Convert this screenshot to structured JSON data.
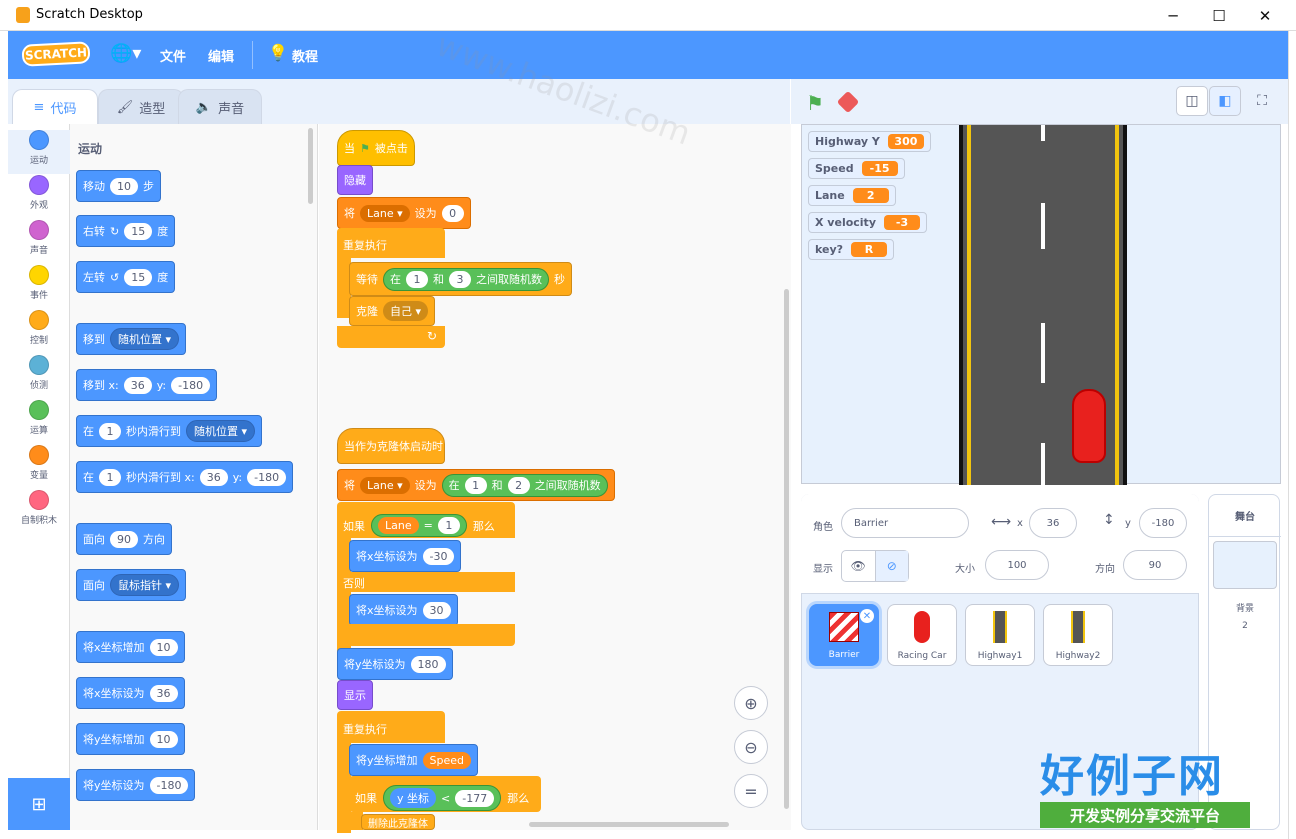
{
  "window": {
    "title": "Scratch Desktop",
    "controls": [
      "─",
      "☐",
      "✕"
    ]
  },
  "menu": {
    "logo": "SCRATCH",
    "globe_icon": "globe-icon",
    "file": "文件",
    "edit": "编辑",
    "tutorials": "教程"
  },
  "tabs": {
    "code": "代码",
    "costumes": "造型",
    "sounds": "声音"
  },
  "categories": [
    {
      "label": "运动",
      "color": "#4c97ff"
    },
    {
      "label": "外观",
      "color": "#9966ff"
    },
    {
      "label": "声音",
      "color": "#cf63cf"
    },
    {
      "label": "事件",
      "color": "#ffd500"
    },
    {
      "label": "控制",
      "color": "#ffab19"
    },
    {
      "label": "侦测",
      "color": "#5cb1d6"
    },
    {
      "label": "运算",
      "color": "#59c059"
    },
    {
      "label": "变量",
      "color": "#ff8c1a"
    },
    {
      "label": "自制积木",
      "color": "#ff6680"
    }
  ],
  "palette": {
    "heading": "运动",
    "b1": {
      "t1": "移动",
      "v1": "10",
      "t2": "步"
    },
    "b2": {
      "t1": "右转",
      "v1": "15",
      "t2": "度"
    },
    "b3": {
      "t1": "左转",
      "v1": "15",
      "t2": "度"
    },
    "b4": {
      "t1": "移到",
      "v1": "随机位置"
    },
    "b5": {
      "t1": "移到 x:",
      "v1": "36",
      "t2": "y:",
      "v2": "-180"
    },
    "b6": {
      "t1": "在",
      "v1": "1",
      "t2": "秒内滑行到",
      "v2": "随机位置"
    },
    "b7": {
      "t1": "在",
      "v1": "1",
      "t2": "秒内滑行到 x:",
      "v2": "36",
      "t3": "y:",
      "v3": "-180"
    },
    "b8": {
      "t1": "面向",
      "v1": "90",
      "t2": "方向"
    },
    "b9": {
      "t1": "面向",
      "v1": "鼠标指针"
    },
    "b10": {
      "t1": "将x坐标增加",
      "v1": "10"
    },
    "b11": {
      "t1": "将x坐标设为",
      "v1": "36"
    },
    "b12": {
      "t1": "将y坐标增加",
      "v1": "10"
    },
    "b13": {
      "t1": "将y坐标设为",
      "v1": "-180"
    }
  },
  "script1": {
    "hat_when": "当",
    "hat_clicked": "被点击",
    "hide": "隐藏",
    "set": "将",
    "set_var": "Lane",
    "set_to": "设为",
    "set_val": "0",
    "forever": "重复执行",
    "wait": "等待",
    "wait_in": "在",
    "wait_a": "1",
    "wait_and": "和",
    "wait_b": "3",
    "wait_rand": "之间取随机数",
    "wait_sec": "秒",
    "clone": "克隆",
    "clone_target": "自己"
  },
  "script2": {
    "hat": "当作为克隆体启动时",
    "set": "将",
    "set_var": "Lane",
    "set_to": "设为",
    "in": "在",
    "a": "1",
    "and": "和",
    "b": "2",
    "rand": "之间取随机数",
    "if": "如果",
    "cond_var": "Lane",
    "eq": "=",
    "cond_val": "1",
    "then": "那么",
    "setx1": "将x坐标设为",
    "setx1_v": "-30",
    "else": "否则",
    "setx2": "将x坐标设为",
    "setx2_v": "30",
    "sety": "将y坐标设为",
    "sety_v": "180",
    "show": "显示",
    "forever": "重复执行",
    "changey": "将y坐标增加",
    "changey_v": "Speed",
    "if2": "如果",
    "ycoord": "y 坐标",
    "lt": "<",
    "lt_v": "-177",
    "then2": "那么",
    "del": "删除此克隆体"
  },
  "monitors": [
    {
      "name": "Highway Y",
      "value": "300"
    },
    {
      "name": "Speed",
      "value": "-15"
    },
    {
      "name": "Lane",
      "value": "2"
    },
    {
      "name": "X velocity",
      "value": "-3"
    },
    {
      "name": "key?",
      "value": "R"
    }
  ],
  "sprite_info": {
    "sprite_label": "角色",
    "sprite_name": "Barrier",
    "x_label": "x",
    "x": "36",
    "y_label": "y",
    "y": "-180",
    "show_label": "显示",
    "size_label": "大小",
    "size": "100",
    "dir_label": "方向",
    "dir": "90"
  },
  "sprites": [
    "Barrier",
    "Racing Car",
    "Highway1",
    "Highway2"
  ],
  "stage_panel": {
    "title": "舞台",
    "backdrops_label": "背景",
    "backdrops_count": "2"
  },
  "watermark": {
    "url": "www.haolizi.com",
    "cn": "好例子网",
    "sub": "开发实例分享交流平台"
  },
  "colors": {
    "primary": "#4c97ff",
    "menu": "#4c97ff"
  }
}
